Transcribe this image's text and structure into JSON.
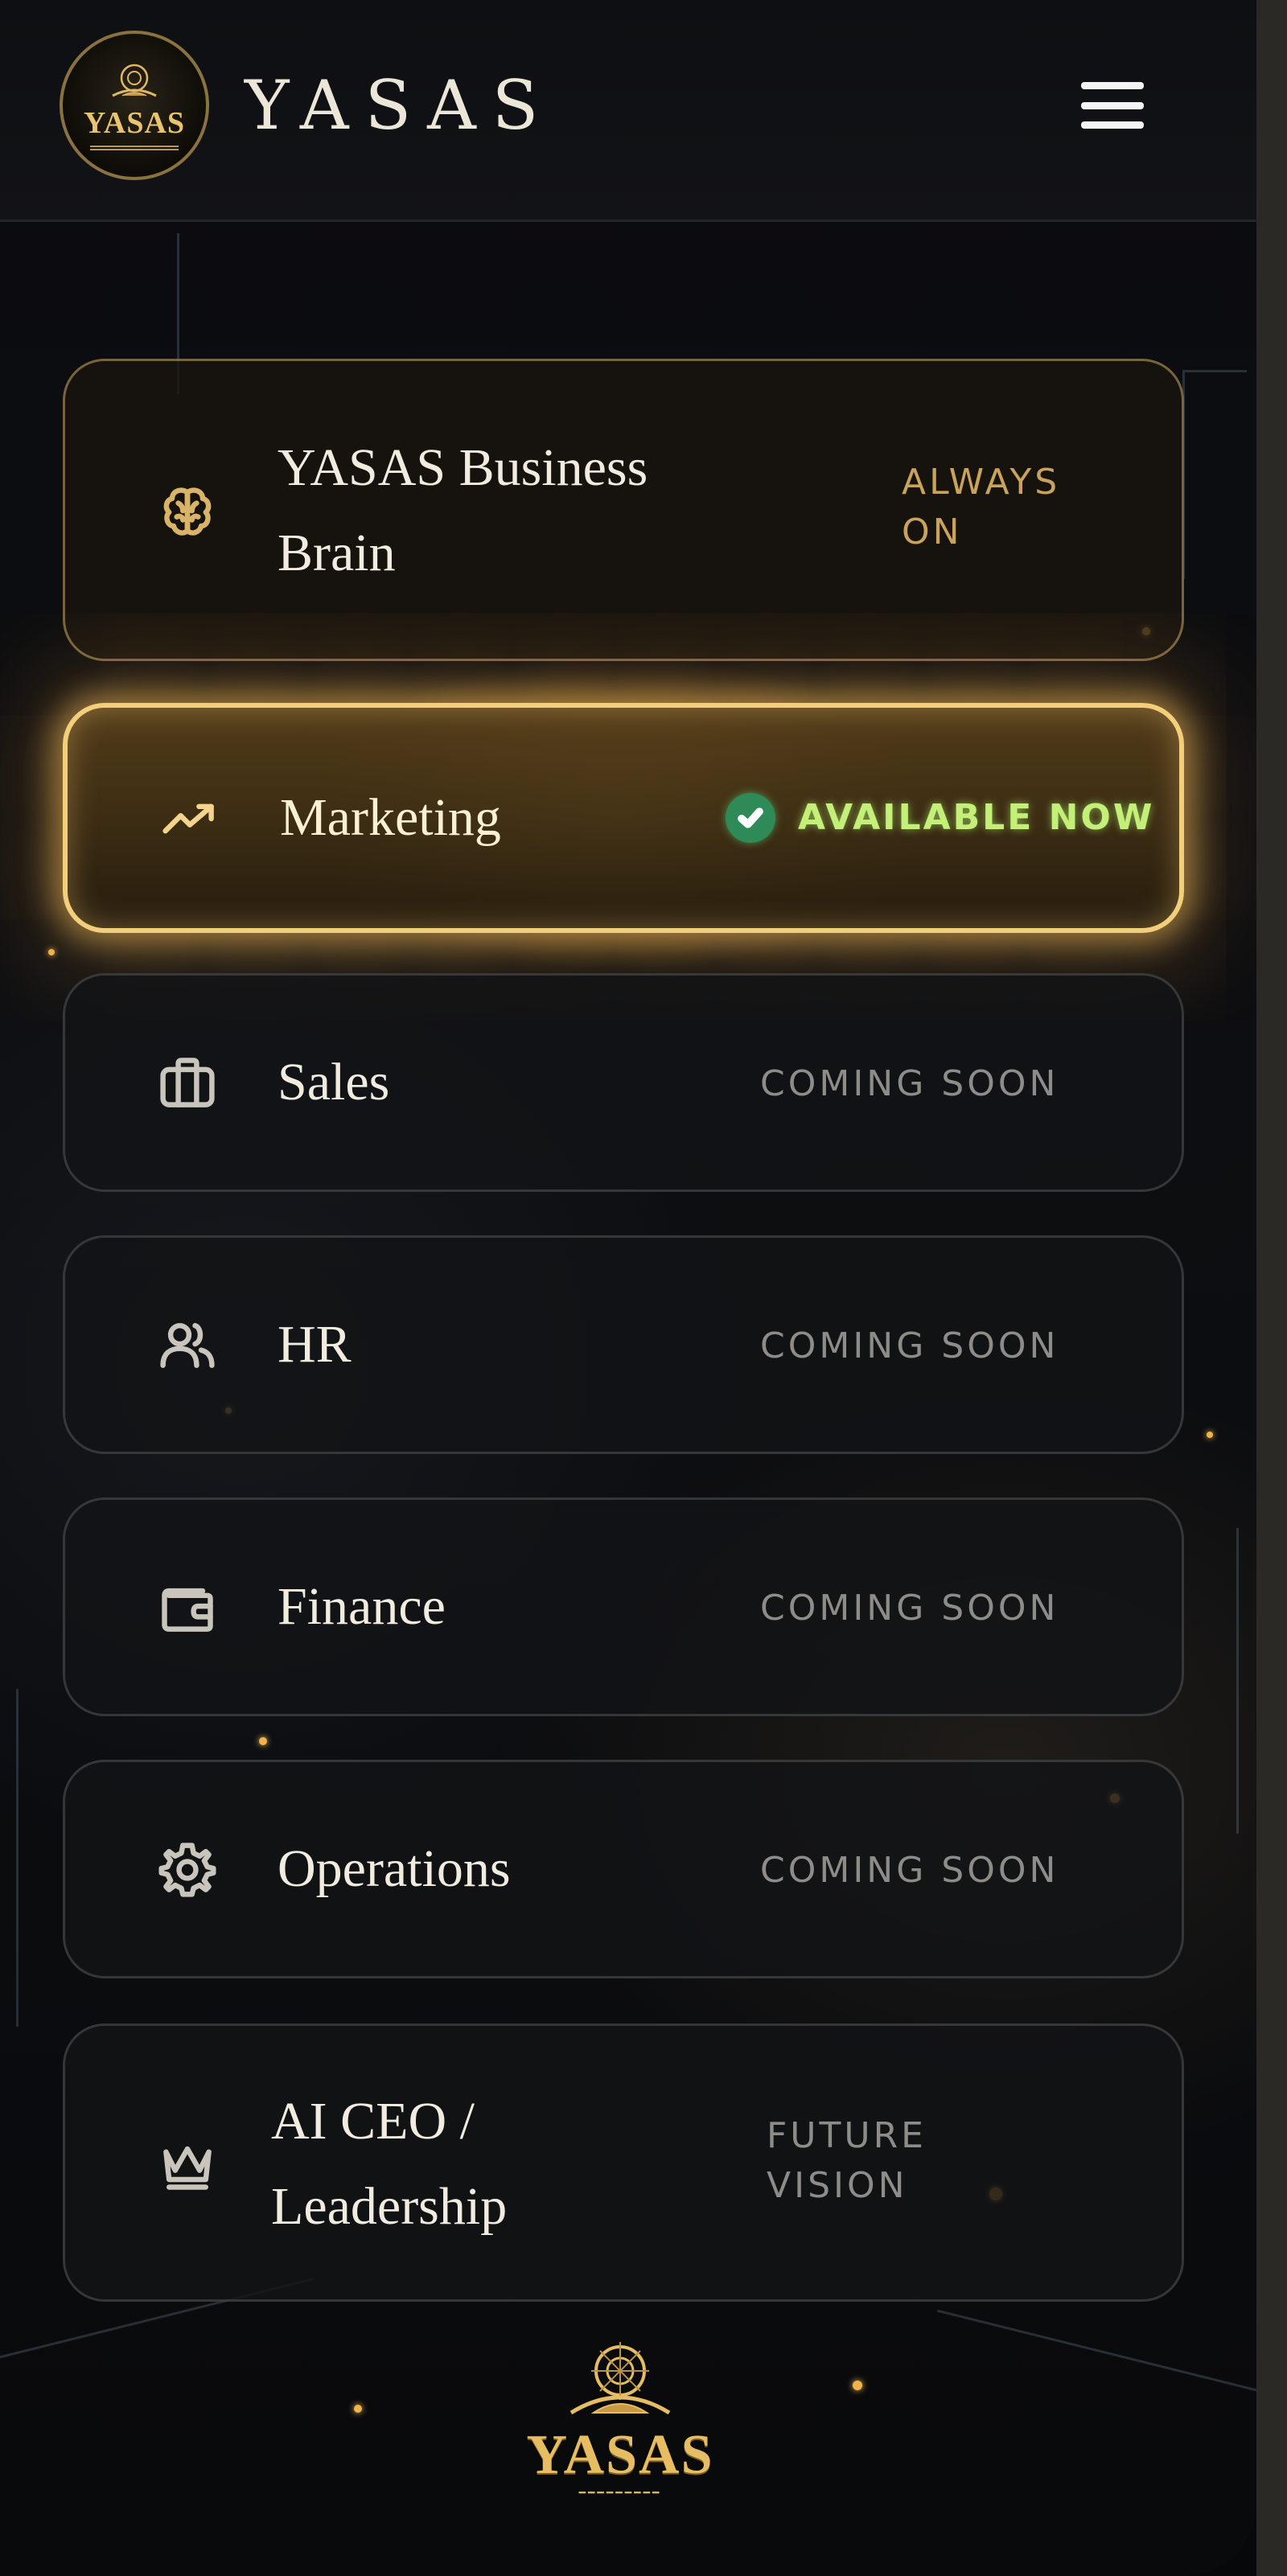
{
  "header": {
    "logo_text": "YASAS",
    "brand_title": "YASAS",
    "menu_icon": "hamburger-menu-icon"
  },
  "modules": [
    {
      "id": "business-brain",
      "icon": "brain-icon",
      "label_line1": "YASAS Business",
      "label_line2": "Brain",
      "status_line1": "ALWAYS",
      "status_line2": "ON"
    },
    {
      "id": "marketing",
      "icon": "trending-up-icon",
      "label": "Marketing",
      "status": "AVAILABLE NOW",
      "status_icon": "check-circle-icon"
    },
    {
      "id": "sales",
      "icon": "briefcase-icon",
      "label": "Sales",
      "status": "COMING SOON"
    },
    {
      "id": "hr",
      "icon": "users-icon",
      "label": "HR",
      "status": "COMING SOON"
    },
    {
      "id": "finance",
      "icon": "wallet-icon",
      "label": "Finance",
      "status": "COMING SOON"
    },
    {
      "id": "operations",
      "icon": "gear-icon",
      "label": "Operations",
      "status": "COMING SOON"
    },
    {
      "id": "ai-ceo",
      "icon": "crown-icon",
      "label_line1": "AI CEO /",
      "label_line2": "Leadership",
      "status_line1": "FUTURE",
      "status_line2": "VISION"
    }
  ],
  "footer": {
    "logo_text": "YASAS"
  },
  "colors": {
    "gold": "#e6bd62",
    "glow": "#f4cf7b",
    "available_green": "#c4f07a",
    "check_bg": "#2e8b57",
    "muted_status": "#8e8c88"
  }
}
